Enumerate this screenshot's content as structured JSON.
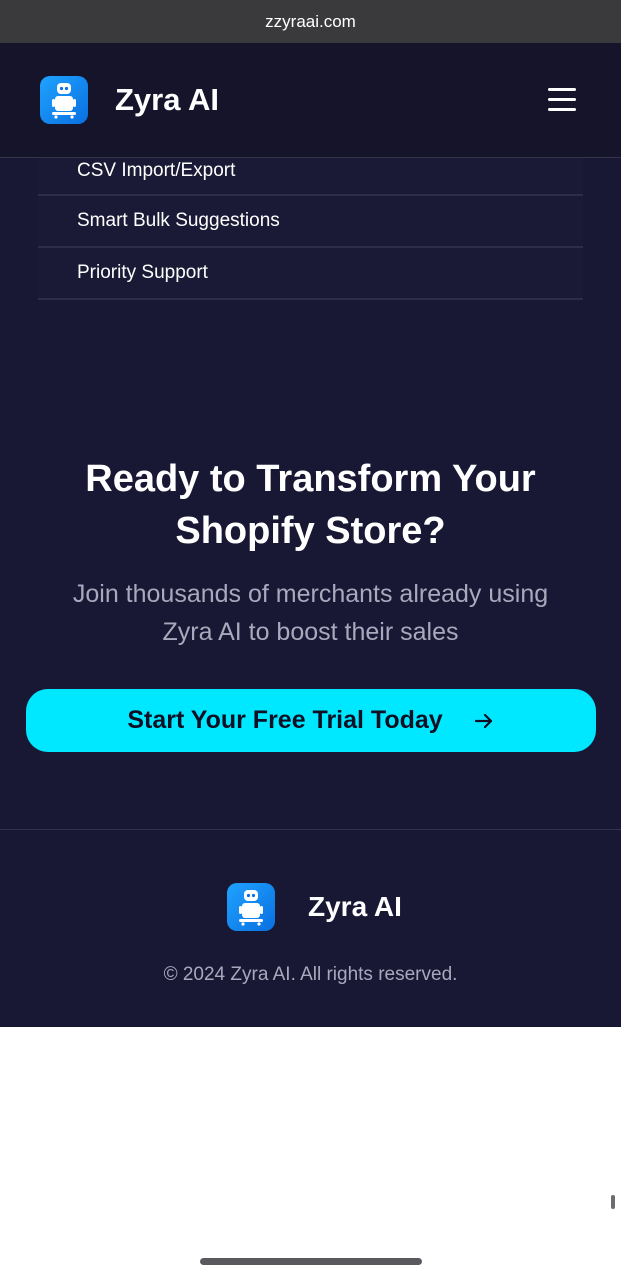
{
  "browser": {
    "url": "zzyraai.com"
  },
  "header": {
    "brand": "Zyra AI",
    "logo_icon": "robot-icon",
    "menu_icon": "hamburger-menu-icon"
  },
  "features": [
    {
      "label": "CSV Import/Export"
    },
    {
      "label": "Smart Bulk Suggestions"
    },
    {
      "label": "Priority Support"
    }
  ],
  "cta": {
    "title_line1": "Ready to Transform Your",
    "title_line2": "Shopify Store?",
    "subtitle_line1": "Join thousands of merchants already using",
    "subtitle_line2": "Zyra AI to boost their sales",
    "button_label": "Start Your Free Trial Today",
    "button_icon": "arrow-right-icon",
    "button_color": "#00e8ff"
  },
  "footer": {
    "brand": "Zyra AI",
    "copyright": "© 2024 Zyra AI. All rights reserved."
  },
  "colors": {
    "page_bg": "#181734",
    "header_bg": "#15142b",
    "logo_blue": "#1fa3ff"
  }
}
